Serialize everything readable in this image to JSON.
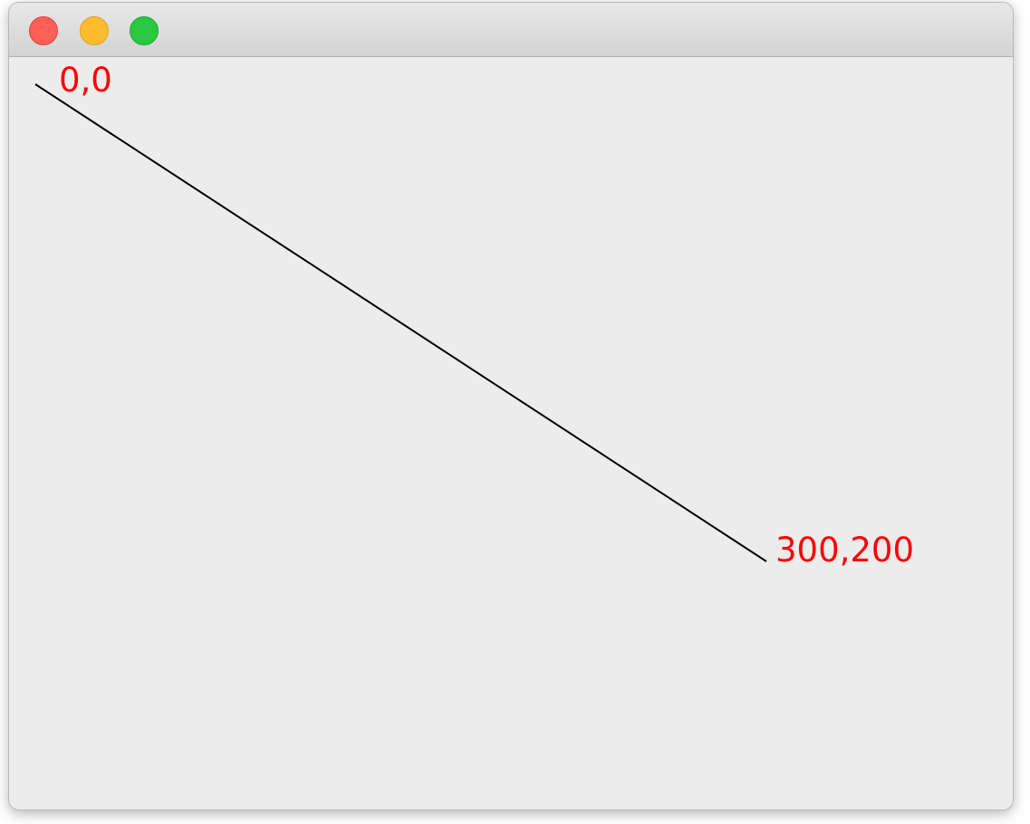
{
  "window": {
    "controls": [
      {
        "name": "close",
        "color": "#ff5f57",
        "border": "#e0443e"
      },
      {
        "name": "minimize",
        "color": "#febc2e",
        "border": "#dea123"
      },
      {
        "name": "zoom",
        "color": "#28c840",
        "border": "#1aab29"
      }
    ]
  },
  "canvas": {
    "line_color": "#000000",
    "label_color": "#ff0000",
    "start_label": "0,0",
    "end_label": "300,200"
  }
}
